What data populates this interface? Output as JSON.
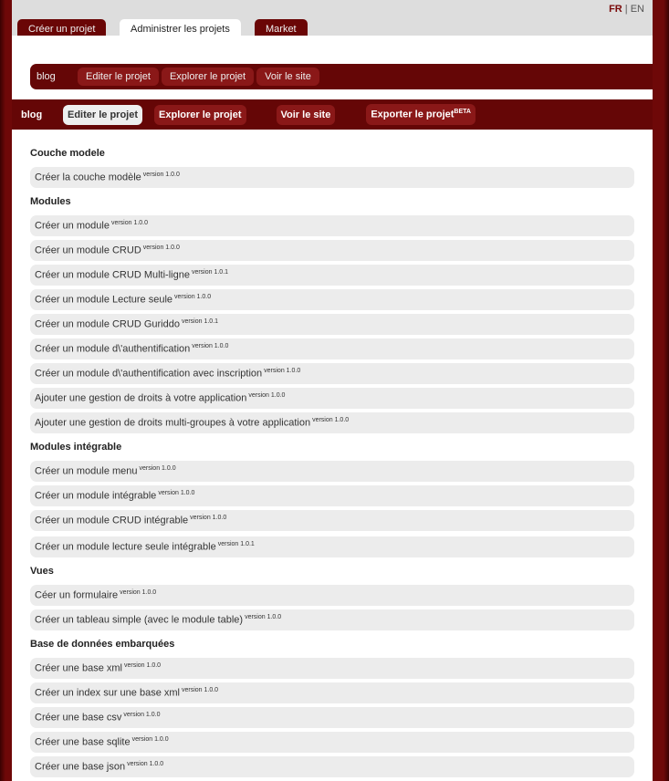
{
  "lang": {
    "fr": "FR",
    "sep": "|",
    "en": "EN"
  },
  "top_tabs": [
    "Créer un projet",
    "Administrer les projets",
    "Market"
  ],
  "bar1": {
    "project": "blog",
    "buttons": [
      "Editer le projet",
      "Explorer le projet",
      "Voir le site"
    ]
  },
  "bar2": {
    "project": "blog",
    "buttons": [
      "Editer le projet",
      "Explorer le projet",
      "Voir le site",
      "Exporter le projet"
    ],
    "beta": "BETA"
  },
  "sections": [
    {
      "title": "Couche modele",
      "items": [
        {
          "label": "Créer la couche modèle",
          "version": "version 1.0.0"
        }
      ]
    },
    {
      "title": "Modules",
      "items": [
        {
          "label": "Créer un module",
          "version": "version 1.0.0"
        },
        {
          "label": "Créer un module CRUD",
          "version": "version 1.0.0"
        },
        {
          "label": "Créer un module CRUD Multi-ligne",
          "version": "version 1.0.1"
        },
        {
          "label": "Créer un module Lecture seule",
          "version": "version 1.0.0"
        },
        {
          "label": "Créer un module CRUD Guriddo",
          "version": "version 1.0.1"
        },
        {
          "label": "Créer un module d\\'authentification",
          "version": "version 1.0.0"
        },
        {
          "label": "Créer un module d\\'authentification avec inscription",
          "version": "version 1.0.0"
        },
        {
          "label": "Ajouter une gestion de droits à votre application",
          "version": "version 1.0.0"
        },
        {
          "label": "Ajouter une gestion de droits multi-groupes à votre application",
          "version": "version 1.0.0"
        }
      ]
    },
    {
      "title": "Modules intégrable",
      "items": [
        {
          "label": "Créer un module menu",
          "version": "version 1.0.0"
        },
        {
          "label": "Créer un module intégrable",
          "version": "version 1.0.0"
        },
        {
          "label": "Créer un module CRUD intégrable",
          "version": "version 1.0.0"
        },
        {
          "label": "Créer un module lecture seule intégrable",
          "version": "version 1.0.1"
        }
      ]
    },
    {
      "title": "Vues",
      "items": [
        {
          "label": "Céer un formulaire",
          "version": "version 1.0.0"
        },
        {
          "label": "Créer un tableau simple (avec le module table)",
          "version": "version 1.0.0"
        }
      ]
    },
    {
      "title": "Base de données embarquées",
      "items": [
        {
          "label": "Créer une base xml",
          "version": "version 1.0.0"
        },
        {
          "label": "Créer un index sur une base xml",
          "version": "version 1.0.0"
        },
        {
          "label": "Créer une base csv",
          "version": "version 1.0.0"
        },
        {
          "label": "Créer une base sqlite",
          "version": "version 1.0.0"
        },
        {
          "label": "Créer une base json",
          "version": "version 1.0.0"
        }
      ]
    }
  ]
}
